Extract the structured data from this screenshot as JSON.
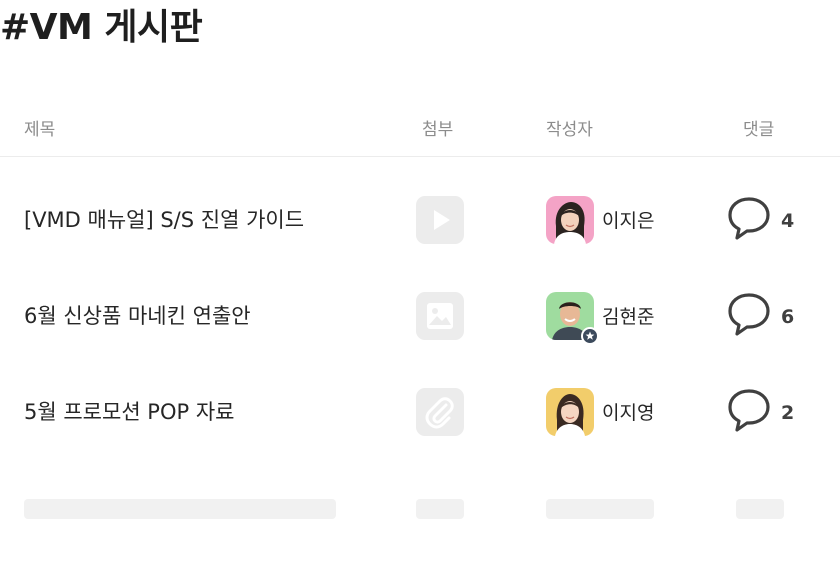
{
  "board": {
    "title": "#VM 게시판"
  },
  "columns": {
    "title": "제목",
    "attachment": "첨부",
    "author": "작성자",
    "comments": "댓글"
  },
  "posts": [
    {
      "title": "[VMD 매뉴얼] S/S 진열 가이드",
      "attachment_type": "play-video-icon",
      "author": "이지은",
      "author_avatar_bg": "#f4a3c6",
      "author_badge": false,
      "comment_count": "4"
    },
    {
      "title": "6월 신상품 마네킨 연출안",
      "attachment_type": "image-icon",
      "author": "김현준",
      "author_avatar_bg": "#9fdc9f",
      "author_badge": true,
      "comment_count": "6"
    },
    {
      "title": "5월 프로모션 POP 자료",
      "attachment_type": "paperclip-icon",
      "author": "이지영",
      "author_avatar_bg": "#f2cd6b",
      "author_badge": false,
      "comment_count": "2"
    }
  ],
  "colors": {
    "attachment_tile": "#ececec",
    "skeleton": "#f1f1f1",
    "header_text": "#8c8c8c",
    "badge": "#3c4a5c"
  }
}
